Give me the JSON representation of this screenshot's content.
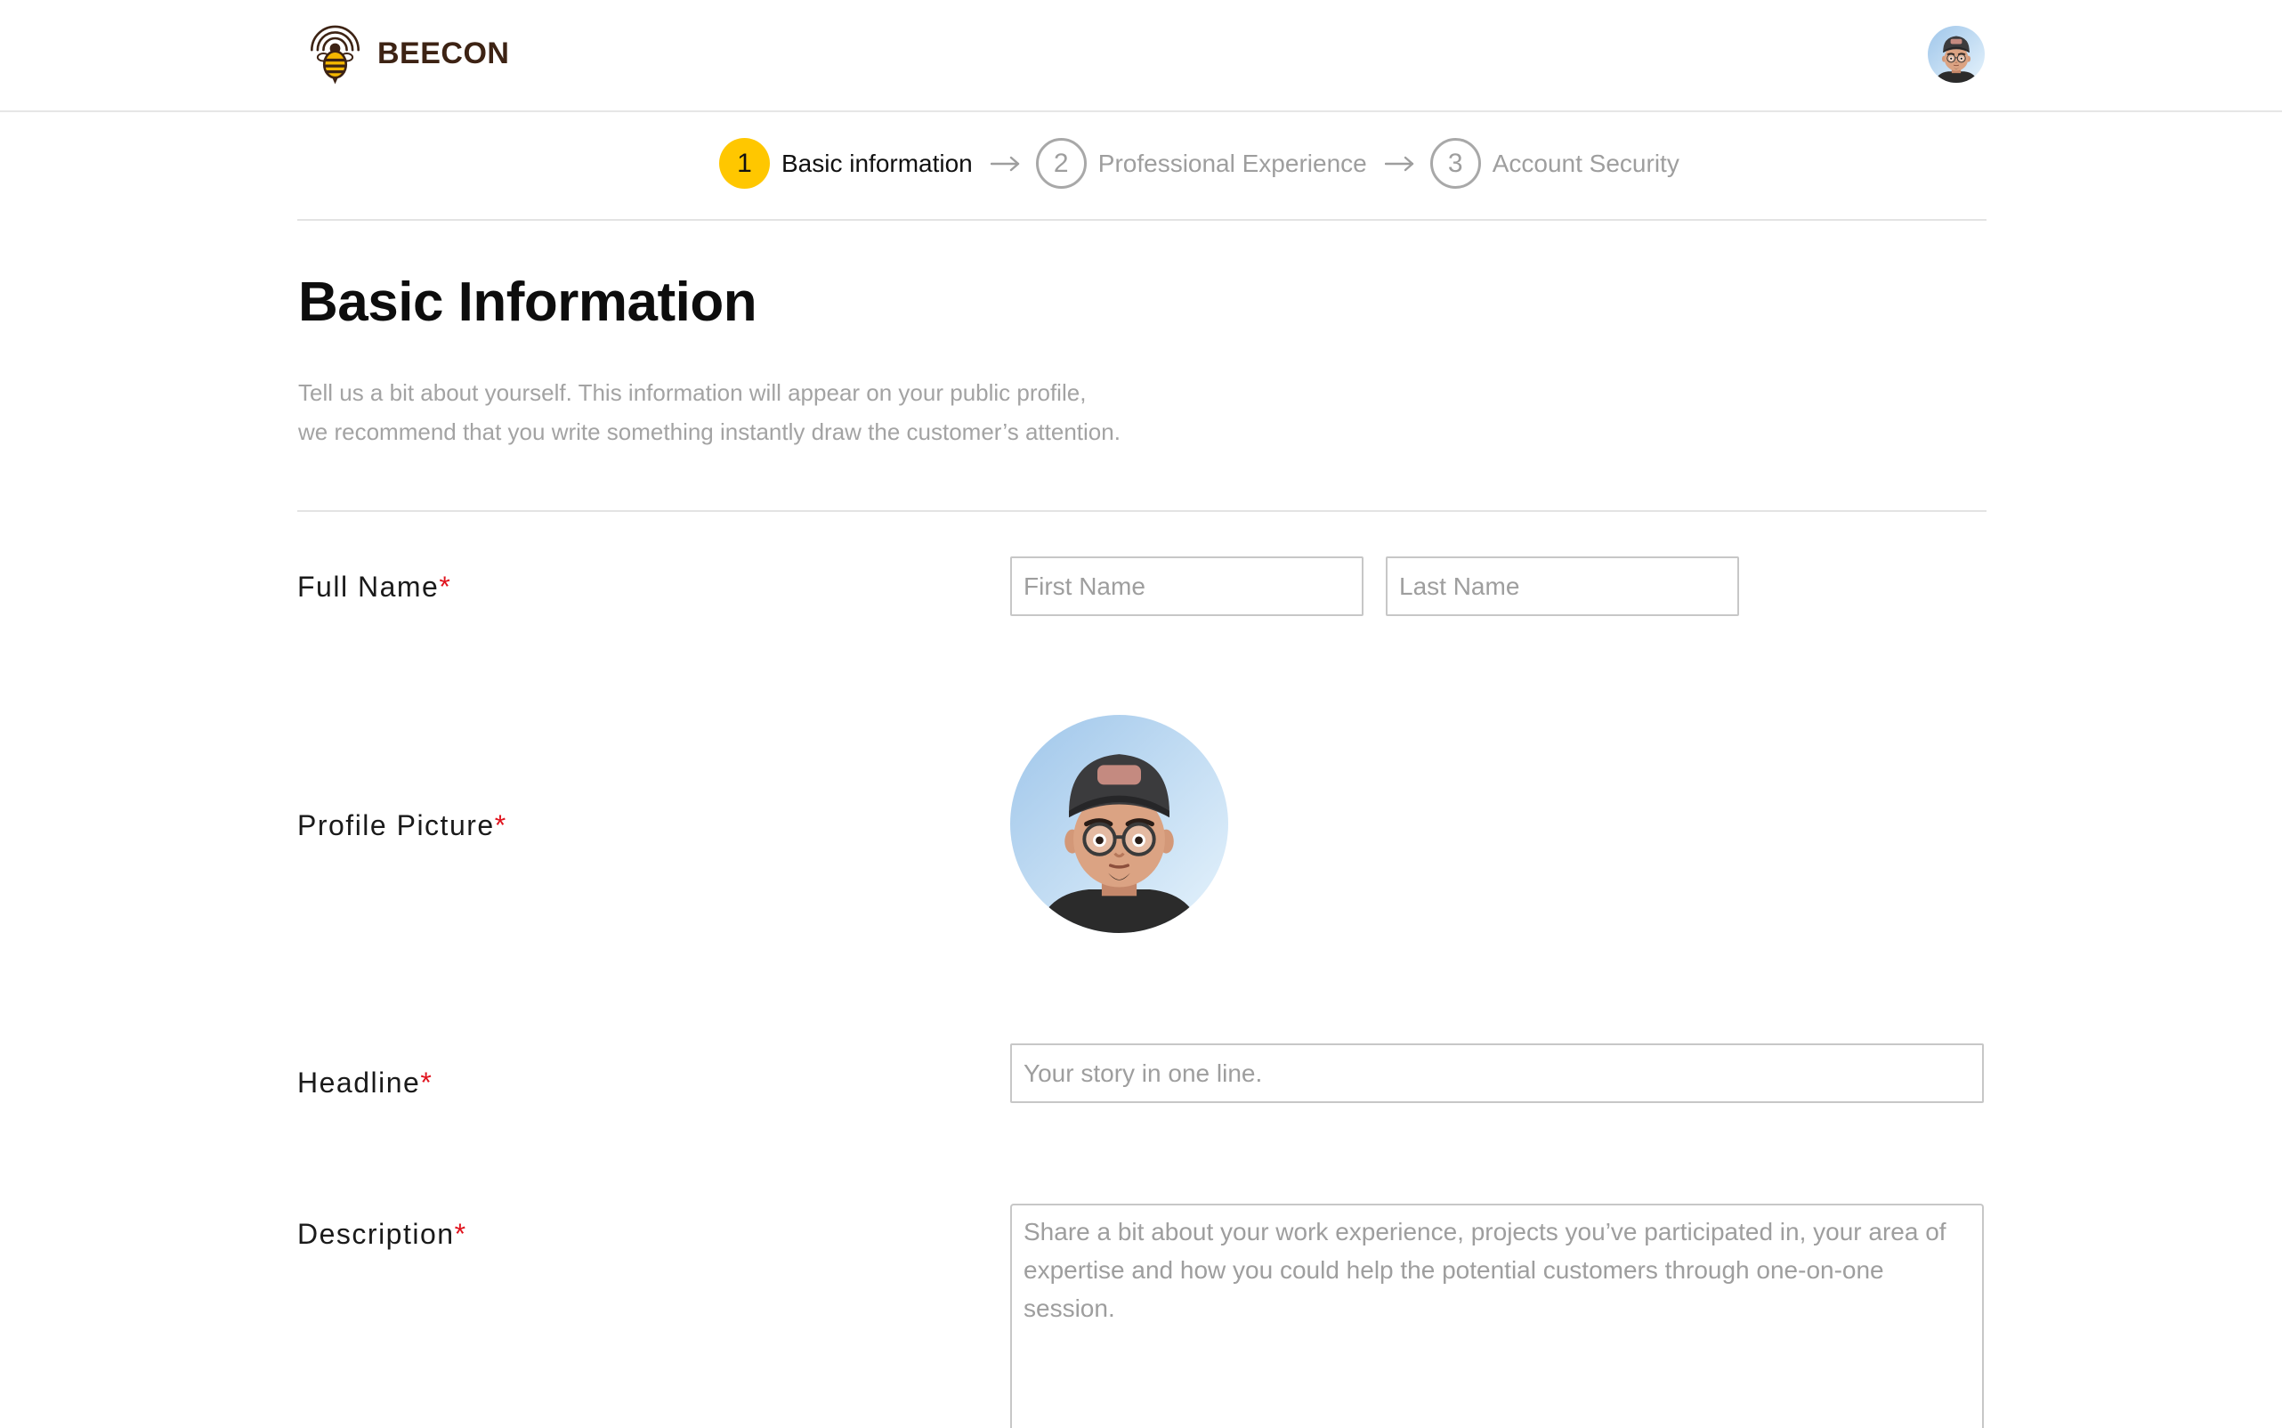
{
  "header": {
    "brand_name": "BEECON",
    "logo_icon": "bee-logo-icon",
    "avatar_icon": "user-avatar"
  },
  "stepper": {
    "separator_icon": "arrow-right-icon",
    "steps": [
      {
        "number": "1",
        "label": "Basic information",
        "state": "active"
      },
      {
        "number": "2",
        "label": "Professional Experience",
        "state": "upcoming"
      },
      {
        "number": "3",
        "label": "Account Security",
        "state": "upcoming"
      }
    ]
  },
  "page": {
    "title": "Basic Information",
    "intro_lines": [
      "Tell us a bit about yourself. This information will appear on your public profile,",
      "we recommend that you write something instantly draw the customer’s attention."
    ]
  },
  "form": {
    "full_name": {
      "label": "Full Name",
      "required_mark": "*",
      "first_name_placeholder": "First Name",
      "last_name_placeholder": "Last Name"
    },
    "profile_picture": {
      "label": "Profile Picture",
      "required_mark": "*",
      "image_icon": "memoji-avatar"
    },
    "headline": {
      "label": "Headline",
      "required_mark": "*",
      "placeholder": "Your story in one line."
    },
    "description": {
      "label": "Description",
      "required_mark": "*",
      "placeholder": "Share a bit about your work experience, projects you’ve participated in, your area of expertise and how you could help the potential customers through one-on-one session."
    }
  },
  "colors": {
    "accent": "#FFC700",
    "brand": "#3D2314",
    "required": "#E0141E",
    "muted_text": "#9E9E9E",
    "input_border": "#C7C7C7"
  }
}
